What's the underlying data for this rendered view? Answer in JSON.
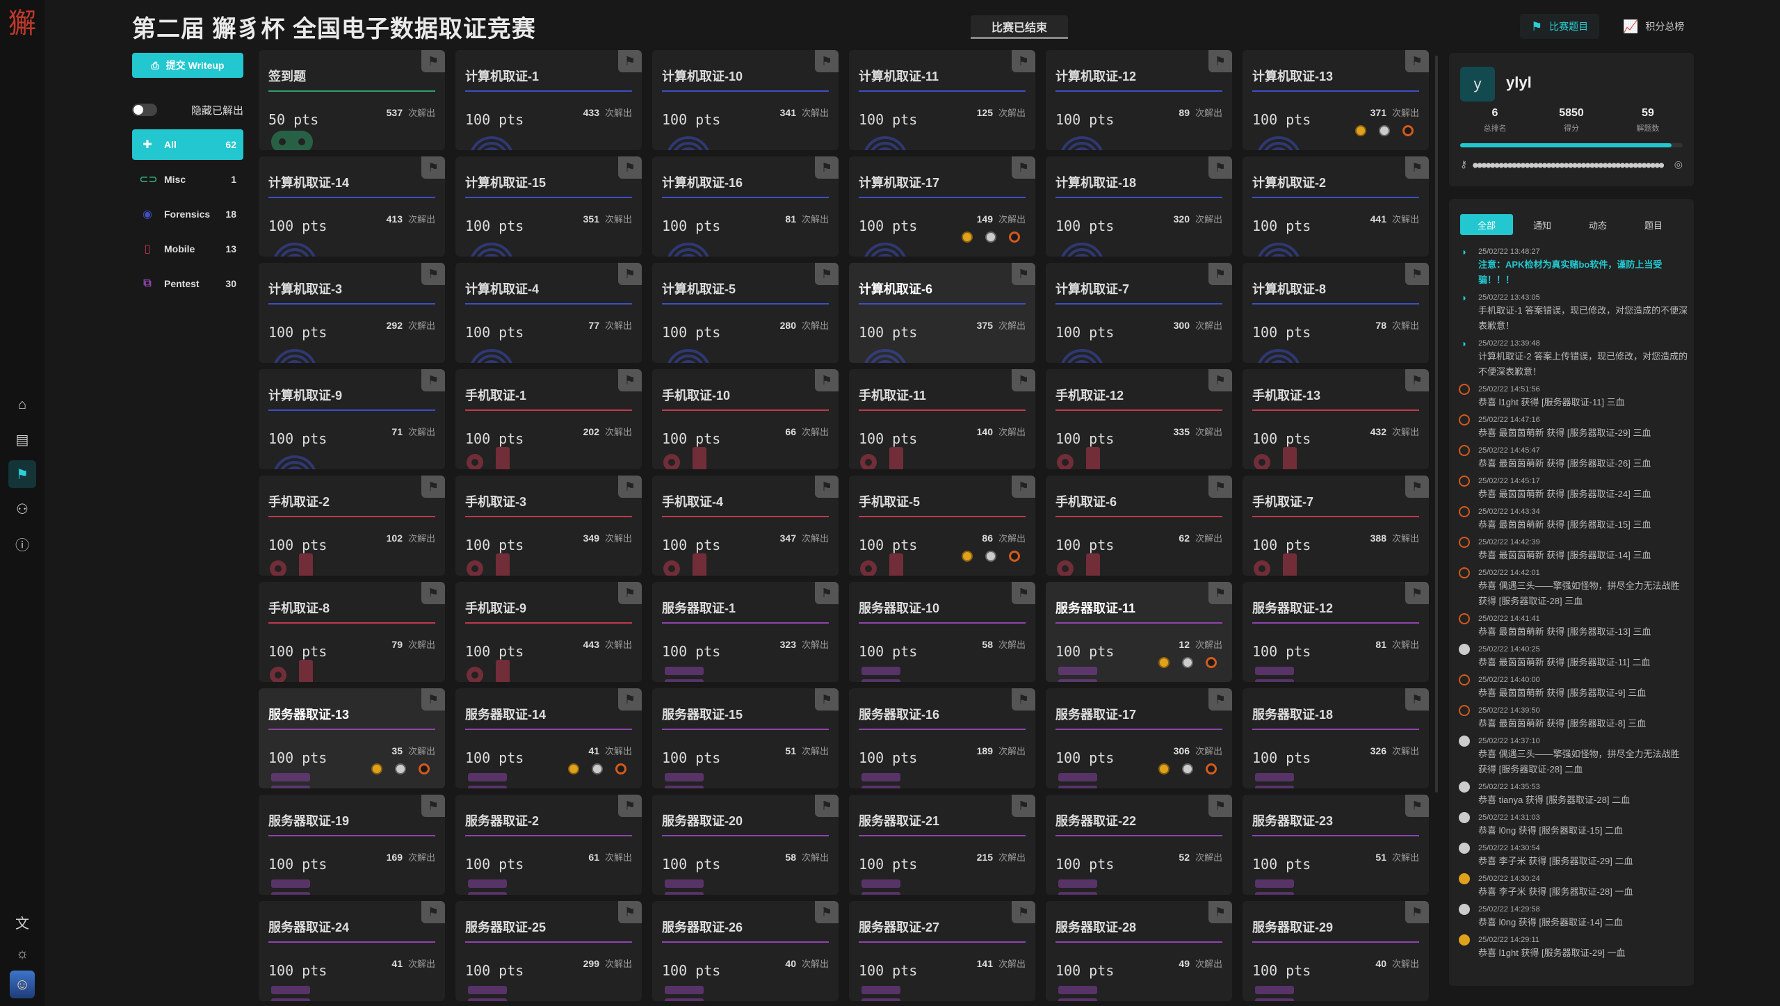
{
  "header": {
    "title": "第二届 獬豸杯 全国电子数据取证竞赛",
    "status": "比赛已结束",
    "tabs": [
      {
        "label": "比赛题目",
        "icon": "flag-icon"
      },
      {
        "label": "积分总榜",
        "icon": "chart-icon"
      }
    ]
  },
  "rail": {
    "items": [
      "home-icon",
      "document-icon",
      "flag-icon",
      "users-icon",
      "info-icon",
      "translate-icon",
      "theme-icon"
    ]
  },
  "sidebar": {
    "writeup_label": "提交 Writeup",
    "hide_solved_label": "隐藏已解出",
    "categories": [
      {
        "label": "All",
        "count": "62"
      },
      {
        "label": "Misc",
        "count": "1"
      },
      {
        "label": "Forensics",
        "count": "18"
      },
      {
        "label": "Mobile",
        "count": "13"
      },
      {
        "label": "Pentest",
        "count": "30"
      }
    ]
  },
  "challenges": [
    {
      "name": "签到题",
      "pts": "50 pts",
      "solves": "537",
      "kind": "misc"
    },
    {
      "name": "计算机取证-1",
      "pts": "100 pts",
      "solves": "433",
      "kind": "pc"
    },
    {
      "name": "计算机取证-10",
      "pts": "100 pts",
      "solves": "341",
      "kind": "pc"
    },
    {
      "name": "计算机取证-11",
      "pts": "100 pts",
      "solves": "125",
      "kind": "pc"
    },
    {
      "name": "计算机取证-12",
      "pts": "100 pts",
      "solves": "89",
      "kind": "pc"
    },
    {
      "name": "计算机取证-13",
      "pts": "100 pts",
      "solves": "371",
      "kind": "pc",
      "medals": true
    },
    {
      "name": "计算机取证-14",
      "pts": "100 pts",
      "solves": "413",
      "kind": "pc"
    },
    {
      "name": "计算机取证-15",
      "pts": "100 pts",
      "solves": "351",
      "kind": "pc"
    },
    {
      "name": "计算机取证-16",
      "pts": "100 pts",
      "solves": "81",
      "kind": "pc"
    },
    {
      "name": "计算机取证-17",
      "pts": "100 pts",
      "solves": "149",
      "kind": "pc",
      "medals": true
    },
    {
      "name": "计算机取证-18",
      "pts": "100 pts",
      "solves": "320",
      "kind": "pc"
    },
    {
      "name": "计算机取证-2",
      "pts": "100 pts",
      "solves": "441",
      "kind": "pc"
    },
    {
      "name": "计算机取证-3",
      "pts": "100 pts",
      "solves": "292",
      "kind": "pc"
    },
    {
      "name": "计算机取证-4",
      "pts": "100 pts",
      "solves": "77",
      "kind": "pc"
    },
    {
      "name": "计算机取证-5",
      "pts": "100 pts",
      "solves": "280",
      "kind": "pc"
    },
    {
      "name": "计算机取证-6",
      "pts": "100 pts",
      "solves": "375",
      "kind": "pc",
      "highlight": true
    },
    {
      "name": "计算机取证-7",
      "pts": "100 pts",
      "solves": "300",
      "kind": "pc"
    },
    {
      "name": "计算机取证-8",
      "pts": "100 pts",
      "solves": "78",
      "kind": "pc"
    },
    {
      "name": "计算机取证-9",
      "pts": "100 pts",
      "solves": "71",
      "kind": "pc"
    },
    {
      "name": "手机取证-1",
      "pts": "100 pts",
      "solves": "202",
      "kind": "mobile"
    },
    {
      "name": "手机取证-10",
      "pts": "100 pts",
      "solves": "66",
      "kind": "mobile"
    },
    {
      "name": "手机取证-11",
      "pts": "100 pts",
      "solves": "140",
      "kind": "mobile"
    },
    {
      "name": "手机取证-12",
      "pts": "100 pts",
      "solves": "335",
      "kind": "mobile"
    },
    {
      "name": "手机取证-13",
      "pts": "100 pts",
      "solves": "432",
      "kind": "mobile"
    },
    {
      "name": "手机取证-2",
      "pts": "100 pts",
      "solves": "102",
      "kind": "mobile"
    },
    {
      "name": "手机取证-3",
      "pts": "100 pts",
      "solves": "349",
      "kind": "mobile"
    },
    {
      "name": "手机取证-4",
      "pts": "100 pts",
      "solves": "347",
      "kind": "mobile"
    },
    {
      "name": "手机取证-5",
      "pts": "100 pts",
      "solves": "86",
      "kind": "mobile",
      "medals": true
    },
    {
      "name": "手机取证-6",
      "pts": "100 pts",
      "solves": "62",
      "kind": "mobile"
    },
    {
      "name": "手机取证-7",
      "pts": "100 pts",
      "solves": "388",
      "kind": "mobile"
    },
    {
      "name": "手机取证-8",
      "pts": "100 pts",
      "solves": "79",
      "kind": "mobile"
    },
    {
      "name": "手机取证-9",
      "pts": "100 pts",
      "solves": "443",
      "kind": "mobile"
    },
    {
      "name": "服务器取证-1",
      "pts": "100 pts",
      "solves": "323",
      "kind": "server"
    },
    {
      "name": "服务器取证-10",
      "pts": "100 pts",
      "solves": "58",
      "kind": "server"
    },
    {
      "name": "服务器取证-11",
      "pts": "100 pts",
      "solves": "12",
      "kind": "server",
      "highlight": true,
      "medals": true
    },
    {
      "name": "服务器取证-12",
      "pts": "100 pts",
      "solves": "81",
      "kind": "server"
    },
    {
      "name": "服务器取证-13",
      "pts": "100 pts",
      "solves": "35",
      "kind": "server",
      "highlight": true,
      "medals": true
    },
    {
      "name": "服务器取证-14",
      "pts": "100 pts",
      "solves": "41",
      "kind": "server",
      "medals": true
    },
    {
      "name": "服务器取证-15",
      "pts": "100 pts",
      "solves": "51",
      "kind": "server"
    },
    {
      "name": "服务器取证-16",
      "pts": "100 pts",
      "solves": "189",
      "kind": "server"
    },
    {
      "name": "服务器取证-17",
      "pts": "100 pts",
      "solves": "306",
      "kind": "server",
      "medals": true
    },
    {
      "name": "服务器取证-18",
      "pts": "100 pts",
      "solves": "326",
      "kind": "server"
    },
    {
      "name": "服务器取证-19",
      "pts": "100 pts",
      "solves": "169",
      "kind": "server"
    },
    {
      "name": "服务器取证-2",
      "pts": "100 pts",
      "solves": "61",
      "kind": "server"
    },
    {
      "name": "服务器取证-20",
      "pts": "100 pts",
      "solves": "58",
      "kind": "server"
    },
    {
      "name": "服务器取证-21",
      "pts": "100 pts",
      "solves": "215",
      "kind": "server"
    },
    {
      "name": "服务器取证-22",
      "pts": "100 pts",
      "solves": "52",
      "kind": "server"
    },
    {
      "name": "服务器取证-23",
      "pts": "100 pts",
      "solves": "51",
      "kind": "server"
    },
    {
      "name": "服务器取证-24",
      "pts": "100 pts",
      "solves": "41",
      "kind": "server"
    },
    {
      "name": "服务器取证-25",
      "pts": "100 pts",
      "solves": "299",
      "kind": "server"
    },
    {
      "name": "服务器取证-26",
      "pts": "100 pts",
      "solves": "40",
      "kind": "server"
    },
    {
      "name": "服务器取证-27",
      "pts": "100 pts",
      "solves": "141",
      "kind": "server"
    },
    {
      "name": "服务器取证-28",
      "pts": "100 pts",
      "solves": "49",
      "kind": "server"
    },
    {
      "name": "服务器取证-29",
      "pts": "100 pts",
      "solves": "40",
      "kind": "server"
    }
  ],
  "solves_suffix": "次解出",
  "profile": {
    "avatar_letter": "y",
    "username": "ylyl",
    "stats": [
      {
        "value": "6",
        "label": "总排名"
      },
      {
        "value": "5850",
        "label": "得分"
      },
      {
        "value": "59",
        "label": "解题数"
      }
    ],
    "progress": 0.95,
    "token_mask": "●●●●●●●●●●●●●●●●●●●●●●●●●●●●●●●●●●●●●●●●●●●●"
  },
  "feed": {
    "tabs": [
      "全部",
      "通知",
      "动态",
      "题目"
    ],
    "items": [
      {
        "type": "note",
        "time": "25/02/22 13:48:27",
        "text": "注意：APK检材为真实赌bo软件，谨防上当受骗！！！",
        "hot": true
      },
      {
        "type": "note",
        "time": "25/02/22 13:43:05",
        "text": "手机取证-1 答案错误，现已修改，对您造成的不便深表歉意！"
      },
      {
        "type": "note",
        "time": "25/02/22 13:39:48",
        "text": "计算机取证-2 答案上传错误，现已修改，对您造成的不便深表歉意！"
      },
      {
        "type": "bronze",
        "time": "25/02/22 14:51:56",
        "text": "恭喜 l1ght 获得 [服务器取证-11] 三血"
      },
      {
        "type": "bronze",
        "time": "25/02/22 14:47:16",
        "text": "恭喜 最茵茵萌新 获得 [服务器取证-29] 三血"
      },
      {
        "type": "bronze",
        "time": "25/02/22 14:45:47",
        "text": "恭喜 最茵茵萌新 获得 [服务器取证-26] 三血"
      },
      {
        "type": "bronze",
        "time": "25/02/22 14:45:17",
        "text": "恭喜 最茵茵萌新 获得 [服务器取证-24] 三血"
      },
      {
        "type": "bronze",
        "time": "25/02/22 14:43:34",
        "text": "恭喜 最茵茵萌新 获得 [服务器取证-15] 三血"
      },
      {
        "type": "bronze",
        "time": "25/02/22 14:42:39",
        "text": "恭喜 最茵茵萌新 获得 [服务器取证-14] 三血"
      },
      {
        "type": "bronze",
        "time": "25/02/22 14:42:01",
        "text": "恭喜 偶遇三头——擎强如怪物，拼尽全力无法战胜 获得 [服务器取证-28] 三血"
      },
      {
        "type": "bronze",
        "time": "25/02/22 14:41:41",
        "text": "恭喜 最茵茵萌新 获得 [服务器取证-13] 三血"
      },
      {
        "type": "silver",
        "time": "25/02/22 14:40:25",
        "text": "恭喜 最茵茵萌新 获得 [服务器取证-11] 二血"
      },
      {
        "type": "bronze",
        "time": "25/02/22 14:40:00",
        "text": "恭喜 最茵茵萌新 获得 [服务器取证-9] 三血"
      },
      {
        "type": "bronze",
        "time": "25/02/22 14:39:50",
        "text": "恭喜 最茵茵萌新 获得 [服务器取证-8] 三血"
      },
      {
        "type": "silver",
        "time": "25/02/22 14:37:10",
        "text": "恭喜 偶遇三头——擎强如怪物，拼尽全力无法战胜 获得 [服务器取证-28] 二血"
      },
      {
        "type": "silver",
        "time": "25/02/22 14:35:53",
        "text": "恭喜 tianya 获得 [服务器取证-28] 二血"
      },
      {
        "type": "silver",
        "time": "25/02/22 14:31:03",
        "text": "恭喜 l0ng 获得 [服务器取证-15] 二血"
      },
      {
        "type": "silver",
        "time": "25/02/22 14:30:54",
        "text": "恭喜 李子米 获得 [服务器取证-29] 二血"
      },
      {
        "type": "gold",
        "time": "25/02/22 14:30:24",
        "text": "恭喜 李子米 获得 [服务器取证-28] 一血"
      },
      {
        "type": "silver",
        "time": "25/02/22 14:29:58",
        "text": "恭喜 l0ng 获得 [服务器取证-14] 二血"
      },
      {
        "type": "gold",
        "time": "25/02/22 14:29:11",
        "text": "恭喜 l1ght 获得 [服务器取证-29] 一血"
      }
    ]
  },
  "colors": {
    "accent": "#22c7cf",
    "pc_line": "#3d4fc4",
    "mobile_line": "#c0394e",
    "server_line": "#8e44ad",
    "misc_line": "#2e9e6b"
  }
}
